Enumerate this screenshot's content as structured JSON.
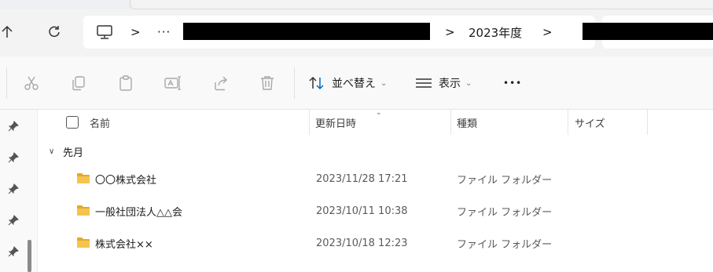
{
  "address": {
    "computer_icon": "monitor-icon",
    "overflow": "···",
    "folder_crumb": "2023年度",
    "separator": ">"
  },
  "toolbar": {
    "sort_label": "並べ替え",
    "view_label": "表示",
    "more_label": "•••",
    "chevron": "⌄"
  },
  "columns": {
    "name": "名前",
    "date": "更新日時",
    "type": "種類",
    "size": "サイズ"
  },
  "group": {
    "label": "先月",
    "chevron": "∨"
  },
  "files": [
    {
      "name": "〇〇株式会社",
      "date": "2023/11/28 17:21",
      "type": "ファイル フォルダー"
    },
    {
      "name": "一般社団法人△△会",
      "date": "2023/10/11 10:38",
      "type": "ファイル フォルダー"
    },
    {
      "name": "株式会社××",
      "date": "2023/10/18 12:23",
      "type": "ファイル フォルダー"
    }
  ],
  "colors": {
    "accent": "#0067c0",
    "folder": "#f4c44e",
    "folder_dark": "#e3a82b",
    "redaction": "#000000"
  }
}
